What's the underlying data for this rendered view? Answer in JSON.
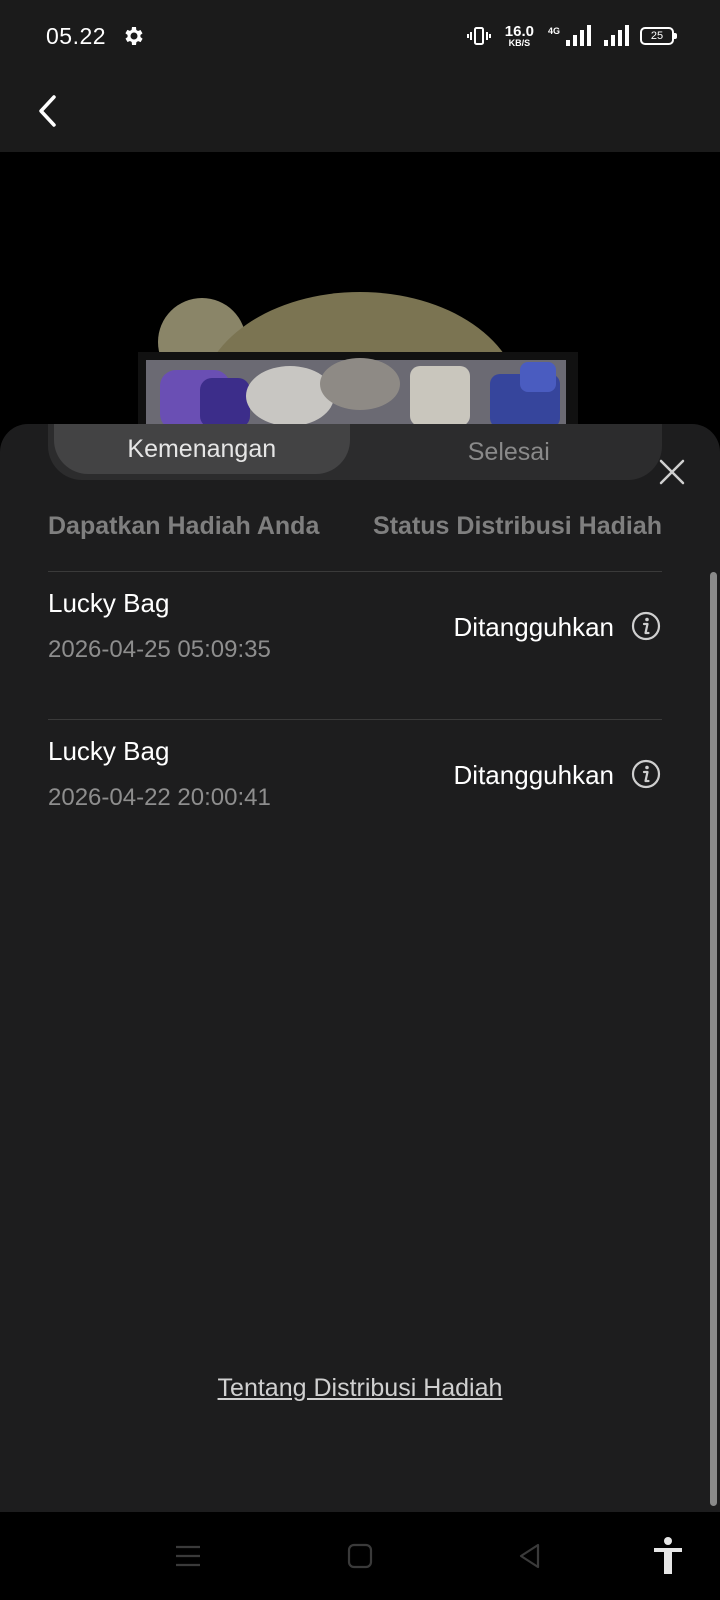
{
  "status_bar": {
    "time": "05.22",
    "net_speed_value": "16.0",
    "net_speed_unit": "KB/S",
    "network_type": "4G",
    "battery": "25"
  },
  "tabs": [
    {
      "label": "Kemenangan",
      "active": true
    },
    {
      "label": "Selesai",
      "active": false
    }
  ],
  "columns": {
    "left": "Dapatkan Hadiah Anda",
    "right": "Status Distribusi Hadiah"
  },
  "rows": [
    {
      "title": "Lucky Bag",
      "date": "2026-04-25 05:09:35",
      "status": "Ditangguhkan"
    },
    {
      "title": "Lucky Bag",
      "date": "2026-04-22 20:00:41",
      "status": "Ditangguhkan"
    }
  ],
  "footer_link": "Tentang Distribusi Hadiah",
  "icons": {
    "back": "back-arrow-icon",
    "close": "close-icon",
    "info": "info-icon",
    "settings": "gear-icon"
  },
  "colors": {
    "sheet_bg": "#1d1d1e",
    "tab_active_bg": "#434344",
    "muted_text": "#8e8e8e"
  }
}
